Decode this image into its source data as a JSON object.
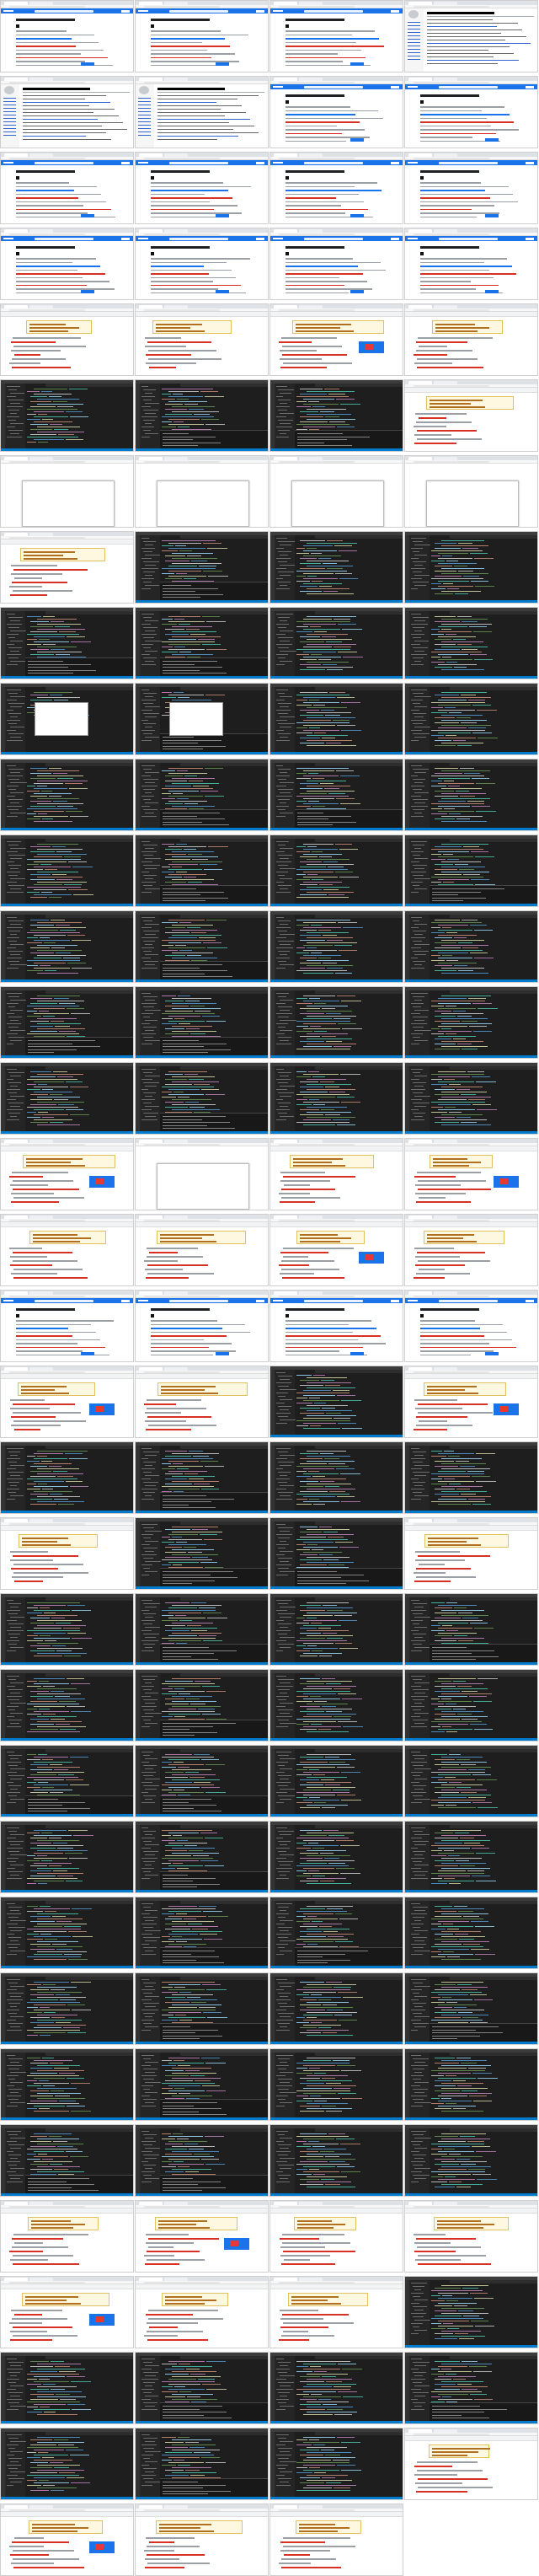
{
  "sheet": {
    "columns": 4,
    "rows": 33,
    "frame_kinds": [
      "browser-wiki",
      "browser-tutorial",
      "ide-dark",
      "browser-form",
      "browser-blank",
      "ide-dialog",
      "empty"
    ]
  },
  "colors": {
    "google_blue": "#1a73e8",
    "ide_bg": "#1e1e1e",
    "ide_side": "#252526",
    "ide_status": "#007acc",
    "error_red": "#d93025"
  },
  "frames": [
    "browser-tutorial",
    "browser-tutorial",
    "browser-tutorial",
    "browser-wiki",
    "browser-wiki",
    "browser-wiki",
    "browser-tutorial",
    "browser-tutorial",
    "browser-tutorial",
    "browser-tutorial",
    "browser-tutorial",
    "browser-tutorial",
    "browser-tutorial",
    "browser-tutorial",
    "browser-tutorial",
    "browser-tutorial",
    "browser-form",
    "browser-form",
    "browser-form",
    "browser-form",
    "ide-dark",
    "ide-dark",
    "ide-dark",
    "browser-form",
    "browser-blank",
    "browser-blank",
    "browser-blank",
    "browser-blank",
    "browser-form",
    "ide-dark",
    "ide-dark",
    "ide-dark",
    "ide-dark",
    "ide-dark",
    "ide-dark",
    "ide-dark",
    "ide-dialog",
    "ide-dialog",
    "ide-dark",
    "ide-dark",
    "ide-dark",
    "ide-dark",
    "ide-dark",
    "ide-dark",
    "ide-dark",
    "ide-dark",
    "ide-dark",
    "ide-dark",
    "ide-dark",
    "ide-dark",
    "ide-dark",
    "ide-dark",
    "ide-dark",
    "ide-dark",
    "ide-dark",
    "ide-dark",
    "ide-dark",
    "ide-dark",
    "ide-dark",
    "ide-dark",
    "browser-form",
    "browser-blank",
    "browser-form",
    "browser-form",
    "browser-form",
    "browser-form",
    "browser-form",
    "browser-form",
    "browser-tutorial",
    "browser-tutorial",
    "browser-tutorial",
    "browser-tutorial",
    "browser-form",
    "browser-form",
    "ide-dark",
    "browser-form",
    "ide-dark",
    "ide-dark",
    "ide-dark",
    "ide-dark",
    "browser-form",
    "ide-dark",
    "ide-dark",
    "browser-form",
    "ide-dark",
    "ide-dark",
    "ide-dark",
    "ide-dark",
    "ide-dark",
    "ide-dark",
    "ide-dark",
    "ide-dark",
    "ide-dark",
    "ide-dark",
    "ide-dark",
    "ide-dark",
    "ide-dark",
    "ide-dark",
    "ide-dark",
    "ide-dark",
    "ide-dark",
    "ide-dark",
    "ide-dark",
    "ide-dark",
    "ide-dark",
    "ide-dark",
    "ide-dark",
    "ide-dark",
    "ide-dark",
    "ide-dark",
    "ide-dark",
    "ide-dark",
    "ide-dark",
    "ide-dark",
    "ide-dark",
    "ide-dark",
    "browser-form",
    "browser-form",
    "browser-form",
    "browser-form",
    "browser-form",
    "browser-form",
    "browser-form",
    "ide-dark",
    "ide-dark",
    "ide-dark",
    "ide-dark",
    "ide-dark",
    "ide-dark",
    "ide-dark",
    "ide-dark",
    "browser-form",
    "browser-form",
    "browser-form",
    "browser-form",
    "empty"
  ]
}
